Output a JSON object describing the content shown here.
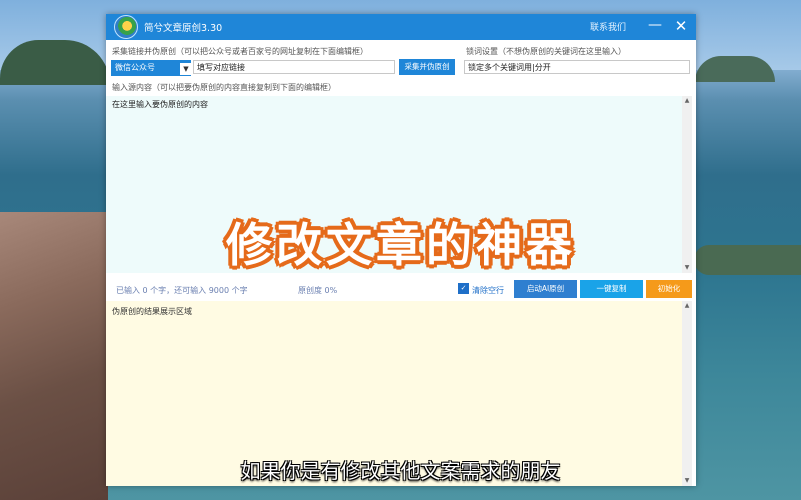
{
  "window": {
    "title": "简兮文章原创3.30",
    "contact_label": "联系我们",
    "minimize_label": "—",
    "close_label": "✕"
  },
  "collect": {
    "label": "采集链接并伪原创（可以把公众号或者百家号的网址复制在下面编辑框）",
    "source_select": "微信公众号",
    "url_placeholder": "填写对应链接",
    "button_label": "采集并伪原创"
  },
  "keywords": {
    "label": "锁词设置（不想伪原创的关键词在这里输入）",
    "placeholder": "锁定多个关键词用|分开"
  },
  "source": {
    "label": "输入源内容（可以把要伪原创的内容直接复制到下面的编辑框）",
    "placeholder": "在这里输入要伪原创的内容"
  },
  "status": {
    "count_text": "已输入 0 个字，还可输入 9000 个字",
    "originality_text": "原创度 0%"
  },
  "actions": {
    "clear_blank_label": "清除空行",
    "clear_blank_checked": true,
    "ai_button_label": "启动AI原创",
    "copy_button_label": "一键复制",
    "init_button_label": "初始化",
    "colors": {
      "ai": "#2f7fd0",
      "copy": "#1aa3e8",
      "init": "#f59a1a"
    }
  },
  "result": {
    "placeholder": "伪原创的结果展示区域"
  },
  "overlay": {
    "banner": "修改文章的神器",
    "subtitle": "如果你是有修改其他文案需求的朋友"
  },
  "theme": {
    "accent": "#1f86d8",
    "source_bg": "#eefbfb",
    "result_bg": "#fffbe3",
    "banner_outline": "#e56a1a"
  }
}
